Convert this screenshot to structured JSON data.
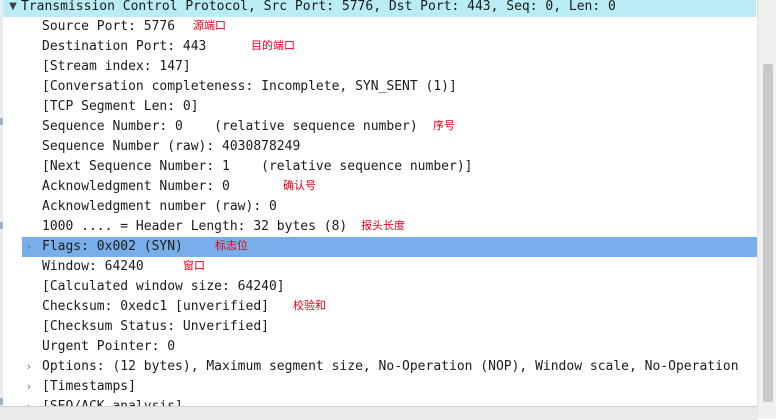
{
  "tree": {
    "header": "Transmission Control Protocol, Src Port: 5776, Dst Port: 443, Seq: 0, Len: 0",
    "rows": [
      {
        "text": "Source Port: 5776",
        "annotation": "源端口"
      },
      {
        "text": "Destination Port: 443",
        "annotation": "目的端口"
      },
      {
        "text": "[Stream index: 147]"
      },
      {
        "text": "[Conversation completeness: Incomplete, SYN_SENT (1)]"
      },
      {
        "text": "[TCP Segment Len: 0]"
      },
      {
        "text": "Sequence Number: 0    (relative sequence number)",
        "annotation": "序号"
      },
      {
        "text": "Sequence Number (raw): 4030878249"
      },
      {
        "text": "[Next Sequence Number: 1    (relative sequence number)]"
      },
      {
        "text": "Acknowledgment Number: 0",
        "annotation": "确认号"
      },
      {
        "text": "Acknowledgment number (raw): 0"
      },
      {
        "text": "1000 .... = Header Length: 32 bytes (8)",
        "annotation": "报头长度"
      },
      {
        "text": "Flags: 0x002 (SYN)",
        "annotation": "标志位"
      },
      {
        "text": "Window: 64240",
        "annotation": "窗口"
      },
      {
        "text": "[Calculated window size: 64240]"
      },
      {
        "text": "Checksum: 0xedc1 [unverified]",
        "annotation": "校验和"
      },
      {
        "text": "[Checksum Status: Unverified]"
      },
      {
        "text": "Urgent Pointer: 0"
      },
      {
        "text": "Options: (12 bytes), Maximum segment size, No-Operation (NOP), Window scale, No-Operation"
      },
      {
        "text": "[Timestamps]"
      },
      {
        "text": "[SEQ/ACK analysis]"
      }
    ]
  },
  "icons": {
    "collapse": "chevron-down-icon",
    "expand": "chevron-right-icon"
  },
  "colors": {
    "header_bg": "#b9ecf5",
    "selected_bg": "#78aee9",
    "annotation": "#e2001a"
  }
}
